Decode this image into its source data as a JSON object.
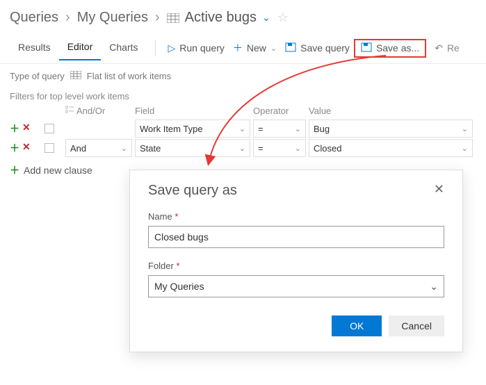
{
  "breadcrumb": {
    "root": "Queries",
    "folder": "My Queries",
    "leaf": "Active bugs"
  },
  "tabs": {
    "results": "Results",
    "editor": "Editor",
    "charts": "Charts"
  },
  "toolbar": {
    "run": "Run query",
    "new": "New",
    "save": "Save query",
    "saveas": "Save as...",
    "revert_partial": "Re"
  },
  "subbar": {
    "type_label": "Type of query",
    "type_value": "Flat list of work items"
  },
  "filters": {
    "title": "Filters for top level work items",
    "headers": {
      "andor": "And/Or",
      "field": "Field",
      "operator": "Operator",
      "value": "Value"
    },
    "rows": [
      {
        "andor": "",
        "field": "Work Item Type",
        "operator": "=",
        "value": "Bug"
      },
      {
        "andor": "And",
        "field": "State",
        "operator": "=",
        "value": "Closed"
      }
    ],
    "add": "Add new clause"
  },
  "dialog": {
    "title": "Save query as",
    "name_label": "Name",
    "name_value": "Closed bugs",
    "folder_label": "Folder",
    "folder_value": "My Queries",
    "ok": "OK",
    "cancel": "Cancel"
  }
}
